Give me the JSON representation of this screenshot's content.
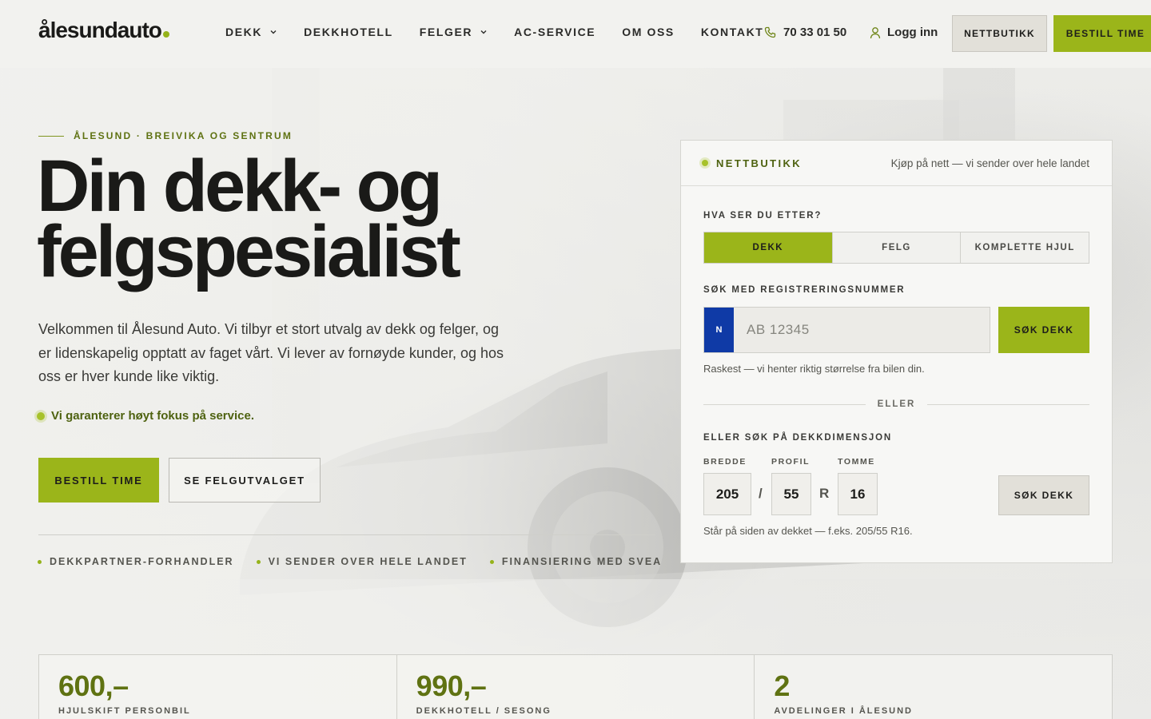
{
  "header": {
    "logo": "ålesundauto",
    "nav": [
      {
        "label": "DEKK",
        "dropdown": true
      },
      {
        "label": "DEKKHOTELL",
        "dropdown": false
      },
      {
        "label": "FELGER",
        "dropdown": true
      },
      {
        "label": "AC-SERVICE",
        "dropdown": false
      },
      {
        "label": "OM OSS",
        "dropdown": false
      },
      {
        "label": "KONTAKT",
        "dropdown": false
      }
    ],
    "phone": "70 33 01 50",
    "login": "Logg inn",
    "shop_button": "NETTBUTIKK",
    "book_button": "BESTILL TIME"
  },
  "hero": {
    "eyebrow": "ÅLESUND · BREIVIKA OG SENTRUM",
    "headline_line1": "Din dekk- og",
    "headline_line2": "felgspesialist",
    "intro": "Velkommen til Ålesund Auto. Vi tilbyr et stort utvalg av dekk og felger, og er lidenskapelig opptatt av faget vårt. Vi lever av fornøyde kunder, og hos oss er hver kunde like viktig.",
    "guarantee": "Vi garanterer høyt fokus på service.",
    "primary_button": "BESTILL TIME",
    "secondary_button": "SE FELGUTVALGET",
    "badges": [
      "DEKKPARTNER-FORHANDLER",
      "VI SENDER OVER HELE LANDET",
      "FINANSIERING MED SVEA"
    ]
  },
  "search_panel": {
    "title": "NETTBUTIKK",
    "subtitle": "Kjøp på nett — vi sender over hele landet",
    "what_label": "HVA SER DU ETTER?",
    "tabs": [
      {
        "label": "DEKK",
        "active": true
      },
      {
        "label": "FELG",
        "active": false
      },
      {
        "label": "KOMPLETTE HJUL",
        "active": false
      }
    ],
    "reg_label": "SØK MED REGISTRERINGSNUMMER",
    "plate_country": "N",
    "plate_placeholder": "AB 12345",
    "plate_button": "SØK DEKK",
    "plate_hint": "Raskest — vi henter riktig størrelse fra bilen din.",
    "or_text": "ELLER",
    "dim_label": "ELLER SØK PÅ DEKKDIMENSJON",
    "width_label": "BREDDE",
    "width_value": "205",
    "profile_label": "PROFIL",
    "profile_value": "55",
    "rim_label": "TOMME",
    "rim_value": "16",
    "separator_slash": "/",
    "separator_r": "R",
    "dim_button": "SØK DEKK",
    "dim_hint": "Står på siden av dekket — f.eks. 205/55 R16."
  },
  "stats": [
    {
      "value": "600,–",
      "label": "HJULSKIFT PERSONBIL"
    },
    {
      "value": "990,–",
      "label": "DEKKHOTELL / SESONG"
    },
    {
      "value": "2",
      "label": "AVDELINGER I ÅLESUND"
    }
  ],
  "colors": {
    "accent": "#9bb51a",
    "accent_dark": "#5f7212",
    "plate_blue": "#0f3aa6",
    "background": "#efefec"
  }
}
